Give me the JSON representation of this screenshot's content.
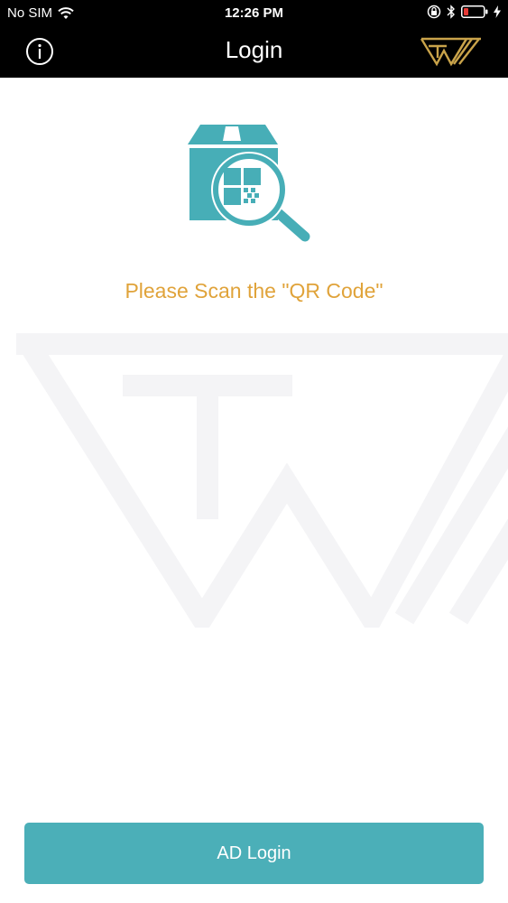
{
  "status_bar": {
    "carrier": "No SIM",
    "time": "12:26 PM"
  },
  "nav": {
    "title": "Login"
  },
  "main": {
    "prompt": "Please Scan the \"QR Code\""
  },
  "actions": {
    "ad_login_label": "AD Login"
  },
  "colors": {
    "nav_background": "#000000",
    "accent_teal": "#4BAFB8",
    "prompt_gold": "#E0A33A",
    "logo_gold": "#C9A34A",
    "battery_low": "#E53935"
  },
  "icons": {
    "info": "info-icon",
    "brand_logo": "brand-logo",
    "illustration": "box-qr-scan-illustration",
    "wifi": "wifi-icon",
    "lock_rotation": "rotation-lock-icon",
    "bluetooth": "bluetooth-icon",
    "battery": "battery-icon",
    "charging": "charging-icon"
  }
}
